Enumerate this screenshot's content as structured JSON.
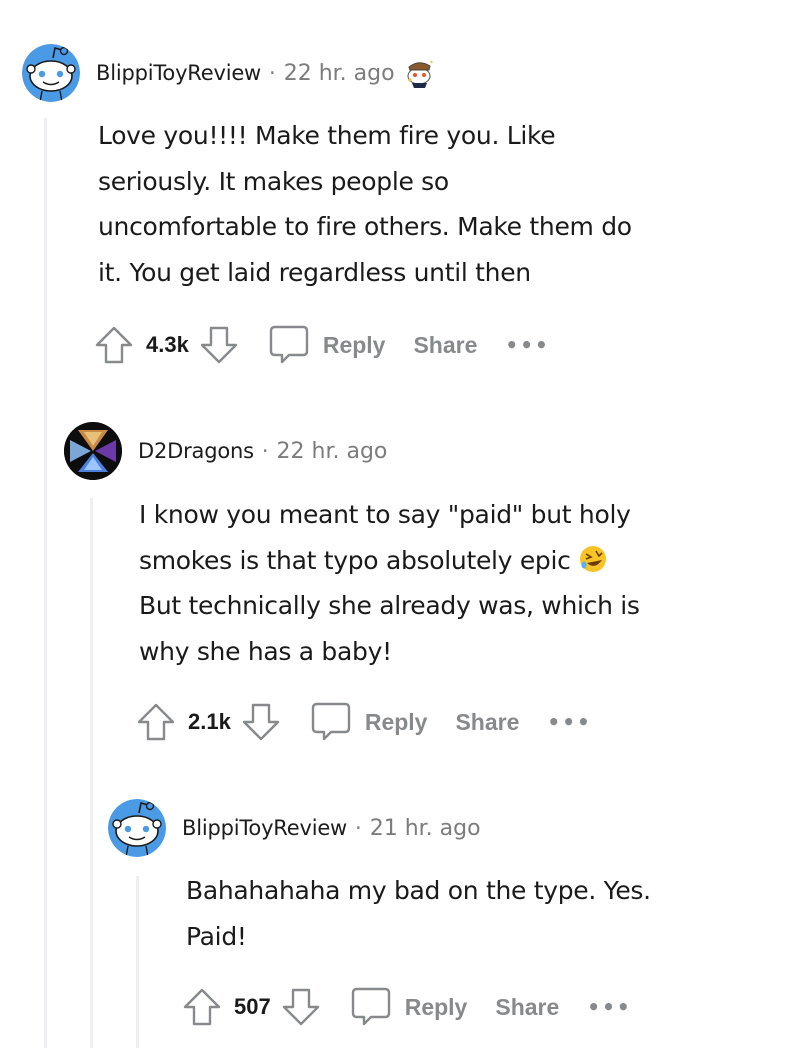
{
  "comments": [
    {
      "username": "BlippiToyReview",
      "separator": "·",
      "time": "22 hr. ago",
      "avatar": "snoo-default-avatar-blue",
      "flair_icon": "snoovatar-icon",
      "body_lines": [
        "Love you!!!! Make them fire you. Like",
        "seriously. It makes people so",
        "uncomfortable to fire others. Make them do",
        "it. You get laid regardless until then"
      ],
      "votes": "4.3k",
      "reply_label": "Reply",
      "share_label": "Share",
      "more_label": "•••"
    },
    {
      "username": "D2Dragons",
      "separator": "·",
      "time": "22 hr. ago",
      "avatar": "elemental-hexagon-avatar",
      "body_lines": [
        "I know you meant to say \"paid\" but holy",
        "smokes is that typo absolutely epic",
        "But technically she already was, which is",
        "why she has a baby!"
      ],
      "emoji": "rolling-on-floor-laughing",
      "votes": "2.1k",
      "reply_label": "Reply",
      "share_label": "Share",
      "more_label": "•••"
    },
    {
      "username": "BlippiToyReview",
      "separator": "·",
      "time": "21 hr. ago",
      "avatar": "snoo-default-avatar-blue",
      "body_lines": [
        "Bahahahaha my bad on the type. Yes.",
        "Paid!"
      ],
      "votes": "507",
      "reply_label": "Reply",
      "share_label": "Share",
      "more_label": "•••"
    }
  ],
  "colors": {
    "avatar_blue": "#4a9ae6",
    "meta_gray": "#7c7c7c",
    "action_gray": "#878a8c",
    "thread_line": "#edeff1",
    "text": "#1a1a1b"
  }
}
